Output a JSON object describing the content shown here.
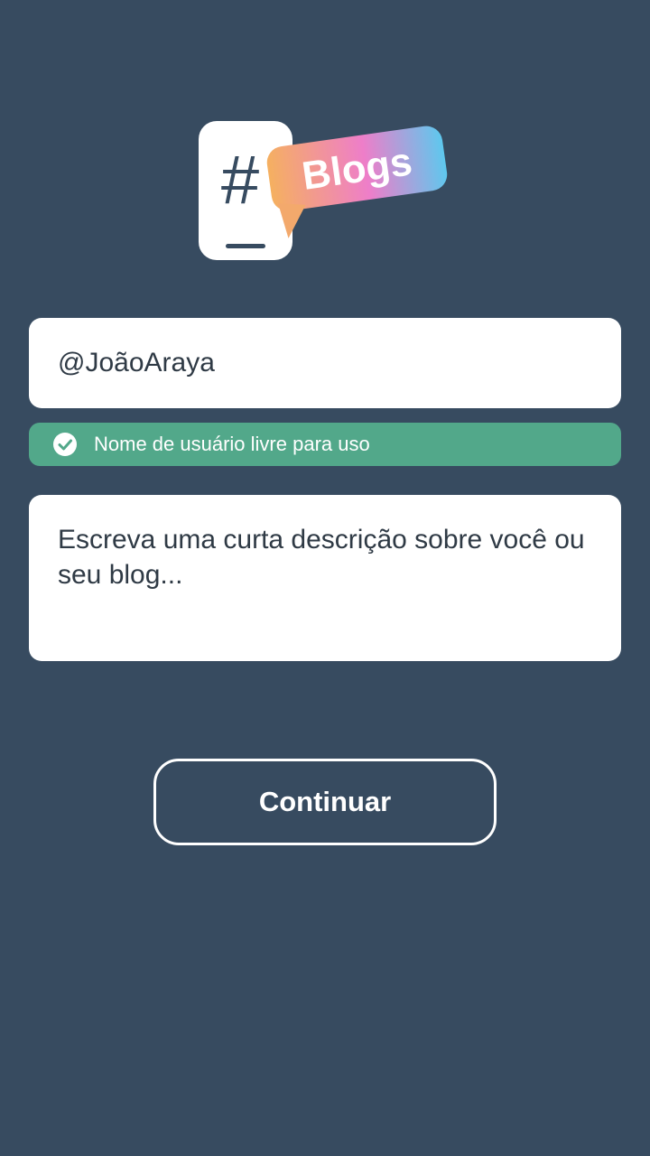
{
  "logo": {
    "hash_symbol": "#",
    "badge_text": "Blogs"
  },
  "username": {
    "value": "@JoãoAraya"
  },
  "status": {
    "icon": "check-circle-icon",
    "text": "Nome de usuário livre para uso",
    "color": "#52a88a"
  },
  "description": {
    "placeholder": "Escreva uma curta descrição sobre você ou seu blog..."
  },
  "actions": {
    "continue_label": "Continuar"
  },
  "colors": {
    "background": "#374b60",
    "field": "#ffffff",
    "text": "#2f3a45",
    "gradient": [
      "#f5b060",
      "#ee7ec9",
      "#5ec8ee"
    ]
  }
}
